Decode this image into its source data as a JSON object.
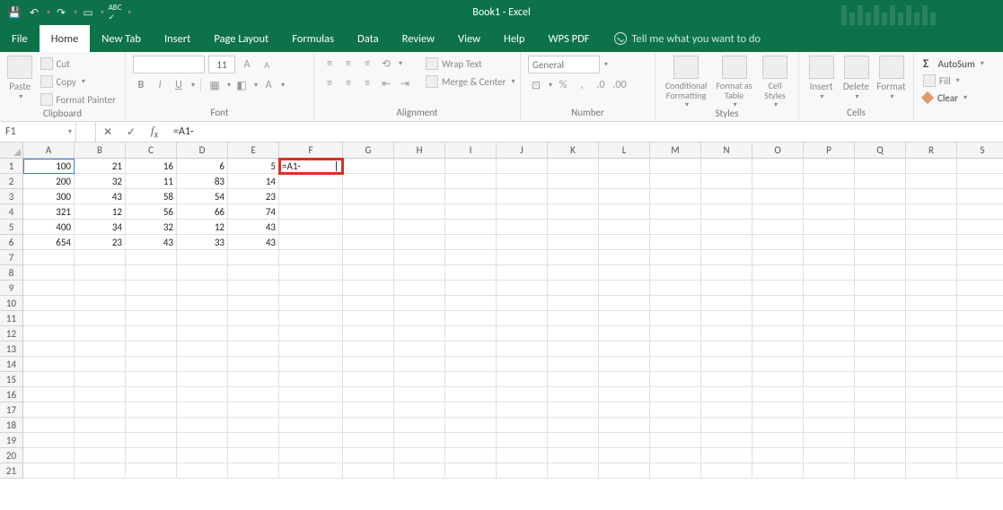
{
  "app": {
    "title": "Book1  -  Excel"
  },
  "qat": {
    "save": "save",
    "undo": "undo",
    "redo": "redo",
    "touch": "touch",
    "spell": "spell"
  },
  "tabs": {
    "file": "File",
    "items": [
      "Home",
      "New Tab",
      "Insert",
      "Page Layout",
      "Formulas",
      "Data",
      "Review",
      "View",
      "Help",
      "WPS PDF"
    ],
    "active_index": 0,
    "tell_me": "Tell me what you want to do"
  },
  "ribbon": {
    "clipboard": {
      "label": "Clipboard",
      "paste": "Paste",
      "cut": "Cut",
      "copy": "Copy",
      "format_painter": "Format Painter"
    },
    "font": {
      "label": "Font",
      "size": "11",
      "bold": "B",
      "italic": "I",
      "underline": "U"
    },
    "alignment": {
      "label": "Alignment",
      "wrap": "Wrap Text",
      "merge": "Merge & Center"
    },
    "number": {
      "label": "Number",
      "format": "General"
    },
    "styles": {
      "label": "Styles",
      "cond": "Conditional Formatting",
      "table": "Format as Table",
      "cell": "Cell Styles"
    },
    "cells": {
      "label": "Cells",
      "insert": "Insert",
      "delete": "Delete",
      "format": "Format"
    },
    "editing": {
      "autosum": "AutoSum",
      "fill": "Fill",
      "clear": "Clear"
    }
  },
  "formula_bar": {
    "name_box": "F1",
    "formula": "=A1-"
  },
  "grid": {
    "columns": [
      "A",
      "B",
      "C",
      "D",
      "E",
      "F",
      "G",
      "H",
      "I",
      "J",
      "K",
      "L",
      "M",
      "N",
      "O",
      "P",
      "Q",
      "R",
      "S"
    ],
    "row_count": 21,
    "f1_value": "=A1-",
    "data": [
      [
        "100",
        "21",
        "16",
        "6",
        "5"
      ],
      [
        "200",
        "32",
        "11",
        "83",
        "14"
      ],
      [
        "300",
        "43",
        "58",
        "54",
        "23"
      ],
      [
        "321",
        "12",
        "56",
        "66",
        "74"
      ],
      [
        "400",
        "34",
        "32",
        "12",
        "43"
      ],
      [
        "654",
        "23",
        "43",
        "33",
        "43"
      ]
    ]
  },
  "chart_data": {
    "type": "table",
    "columns": [
      "A",
      "B",
      "C",
      "D",
      "E"
    ],
    "rows": [
      [
        100,
        21,
        16,
        6,
        5
      ],
      [
        200,
        32,
        11,
        83,
        14
      ],
      [
        300,
        43,
        58,
        54,
        23
      ],
      [
        321,
        12,
        56,
        66,
        74
      ],
      [
        400,
        34,
        32,
        12,
        43
      ],
      [
        654,
        23,
        43,
        33,
        43
      ]
    ]
  }
}
